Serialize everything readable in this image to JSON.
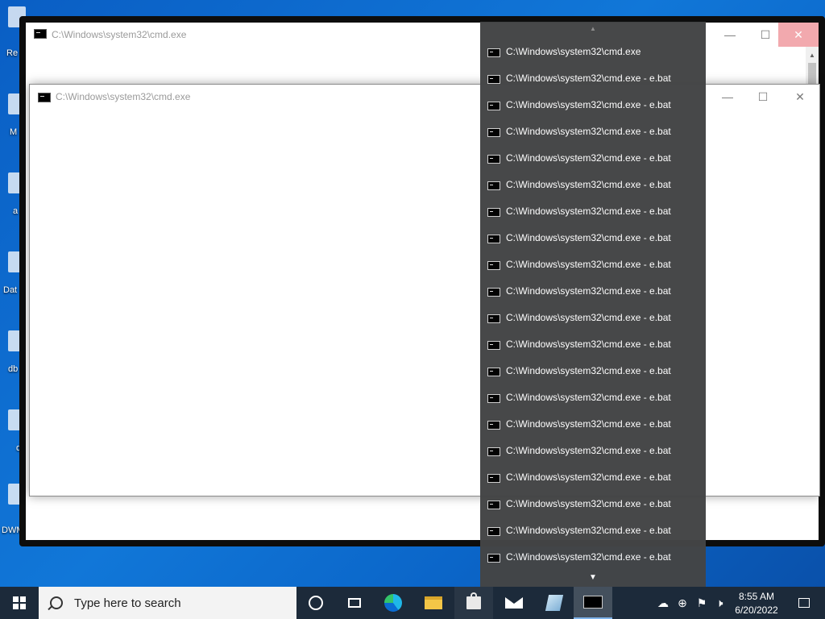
{
  "desktop": {
    "icons": [
      {
        "label": "Re",
        "icon": "recycle-bin-icon"
      },
      {
        "label": "M",
        "icon": "app-icon"
      },
      {
        "label": "a",
        "icon": "file-icon"
      },
      {
        "label": "Dat",
        "icon": "file-icon"
      },
      {
        "label": "db",
        "icon": "file-icon"
      },
      {
        "label": "d",
        "icon": "file-icon"
      },
      {
        "label": "DWM",
        "icon": "file-icon"
      }
    ]
  },
  "windows": {
    "back": {
      "title": "C:\\Windows\\system32\\cmd.exe",
      "minimize": "—",
      "maximize": "☐",
      "close": "✕"
    },
    "front": {
      "title": "C:\\Windows\\system32\\cmd.exe",
      "minimize": "—",
      "maximize": "☐",
      "close": "✕"
    }
  },
  "flyout": {
    "scroll_up": "▲",
    "scroll_down": "▼",
    "items": [
      "C:\\Windows\\system32\\cmd.exe",
      "C:\\Windows\\system32\\cmd.exe - e.bat",
      "C:\\Windows\\system32\\cmd.exe - e.bat",
      "C:\\Windows\\system32\\cmd.exe - e.bat",
      "C:\\Windows\\system32\\cmd.exe - e.bat",
      "C:\\Windows\\system32\\cmd.exe - e.bat",
      "C:\\Windows\\system32\\cmd.exe - e.bat",
      "C:\\Windows\\system32\\cmd.exe - e.bat",
      "C:\\Windows\\system32\\cmd.exe - e.bat",
      "C:\\Windows\\system32\\cmd.exe - e.bat",
      "C:\\Windows\\system32\\cmd.exe - e.bat",
      "C:\\Windows\\system32\\cmd.exe - e.bat",
      "C:\\Windows\\system32\\cmd.exe - e.bat",
      "C:\\Windows\\system32\\cmd.exe - e.bat",
      "C:\\Windows\\system32\\cmd.exe - e.bat",
      "C:\\Windows\\system32\\cmd.exe - e.bat",
      "C:\\Windows\\system32\\cmd.exe - e.bat",
      "C:\\Windows\\system32\\cmd.exe - e.bat",
      "C:\\Windows\\system32\\cmd.exe - e.bat",
      "C:\\Windows\\system32\\cmd.exe - e.bat"
    ]
  },
  "taskbar": {
    "search_placeholder": "Type here to search",
    "apps": [
      "start-icon",
      "cortana-icon",
      "task-view-icon",
      "edge-icon",
      "file-explorer-icon",
      "store-icon",
      "mail-icon",
      "notepad-icon",
      "cmd-icon"
    ],
    "tray": {
      "onedrive": "☁",
      "network": "⊕",
      "security": "⚑",
      "volume": "🕨",
      "time": "8:55 AM",
      "date": "6/20/2022"
    }
  },
  "colors": {
    "desktop": "#0b66c9",
    "taskbar": "#1c2a3a",
    "flyout": "#444546",
    "close_hover": "#f2a9ae"
  }
}
